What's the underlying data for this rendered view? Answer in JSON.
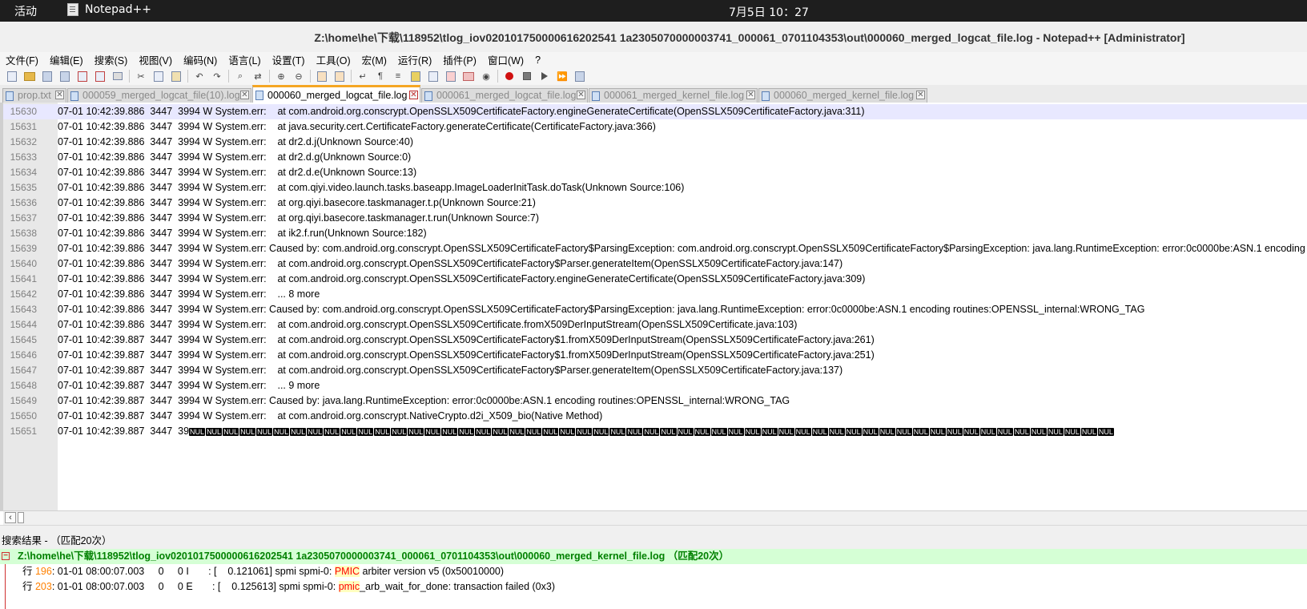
{
  "topbar": {
    "activities": "活动",
    "app_name": "Notepad++",
    "clock": "7月5日  10：27"
  },
  "window": {
    "title": "Z:\\home\\he\\下载\\118952\\tlog_iov020101750000616202541 1a2305070000003741_000061_0701104353\\out\\000060_merged_logcat_file.log - Notepad++ [Administrator]"
  },
  "menu": [
    "文件(F)",
    "编辑(E)",
    "搜索(S)",
    "视图(V)",
    "编码(N)",
    "语言(L)",
    "设置(T)",
    "工具(O)",
    "宏(M)",
    "运行(R)",
    "插件(P)",
    "窗口(W)",
    "?"
  ],
  "tabs": [
    {
      "label": "prop.txt",
      "active": false
    },
    {
      "label": "000059_merged_logcat_file(10).log",
      "active": false
    },
    {
      "label": "000060_merged_logcat_file.log",
      "active": true
    },
    {
      "label": "000061_merged_logcat_file.log",
      "active": false
    },
    {
      "label": "000061_merged_kernel_file.log",
      "active": false
    },
    {
      "label": "000060_merged_kernel_file.log",
      "active": false
    }
  ],
  "editor": {
    "lines": [
      {
        "num": "15630",
        "text": "07-01 10:42:39.886  3447  3994 W System.err:    at com.android.org.conscrypt.OpenSSLX509CertificateFactory.engineGenerateCertificate(OpenSSLX509CertificateFactory.java:311)"
      },
      {
        "num": "15631",
        "text": "07-01 10:42:39.886  3447  3994 W System.err:    at java.security.cert.CertificateFactory.generateCertificate(CertificateFactory.java:366)"
      },
      {
        "num": "15632",
        "text": "07-01 10:42:39.886  3447  3994 W System.err:    at dr2.d.j(Unknown Source:40)"
      },
      {
        "num": "15633",
        "text": "07-01 10:42:39.886  3447  3994 W System.err:    at dr2.d.g(Unknown Source:0)"
      },
      {
        "num": "15634",
        "text": "07-01 10:42:39.886  3447  3994 W System.err:    at dr2.d.e(Unknown Source:13)"
      },
      {
        "num": "15635",
        "text": "07-01 10:42:39.886  3447  3994 W System.err:    at com.qiyi.video.launch.tasks.baseapp.ImageLoaderInitTask.doTask(Unknown Source:106)"
      },
      {
        "num": "15636",
        "text": "07-01 10:42:39.886  3447  3994 W System.err:    at org.qiyi.basecore.taskmanager.t.p(Unknown Source:21)"
      },
      {
        "num": "15637",
        "text": "07-01 10:42:39.886  3447  3994 W System.err:    at org.qiyi.basecore.taskmanager.t.run(Unknown Source:7)"
      },
      {
        "num": "15638",
        "text": "07-01 10:42:39.886  3447  3994 W System.err:    at ik2.f.run(Unknown Source:182)"
      },
      {
        "num": "15639",
        "text": "07-01 10:42:39.886  3447  3994 W System.err: Caused by: com.android.org.conscrypt.OpenSSLX509CertificateFactory$ParsingException: com.android.org.conscrypt.OpenSSLX509CertificateFactory$ParsingException: java.lang.RuntimeException: error:0c0000be:ASN.1 encoding routines:OPENSSL_internal:WRONG_TAG"
      },
      {
        "num": "15640",
        "text": "07-01 10:42:39.886  3447  3994 W System.err:    at com.android.org.conscrypt.OpenSSLX509CertificateFactory$Parser.generateItem(OpenSSLX509CertificateFactory.java:147)"
      },
      {
        "num": "15641",
        "text": "07-01 10:42:39.886  3447  3994 W System.err:    at com.android.org.conscrypt.OpenSSLX509CertificateFactory.engineGenerateCertificate(OpenSSLX509CertificateFactory.java:309)"
      },
      {
        "num": "15642",
        "text": "07-01 10:42:39.886  3447  3994 W System.err:    ... 8 more"
      },
      {
        "num": "15643",
        "text": "07-01 10:42:39.886  3447  3994 W System.err: Caused by: com.android.org.conscrypt.OpenSSLX509CertificateFactory$ParsingException: java.lang.RuntimeException: error:0c0000be:ASN.1 encoding routines:OPENSSL_internal:WRONG_TAG"
      },
      {
        "num": "15644",
        "text": "07-01 10:42:39.886  3447  3994 W System.err:    at com.android.org.conscrypt.OpenSSLX509Certificate.fromX509DerInputStream(OpenSSLX509Certificate.java:103)"
      },
      {
        "num": "15645",
        "text": "07-01 10:42:39.887  3447  3994 W System.err:    at com.android.org.conscrypt.OpenSSLX509CertificateFactory$1.fromX509DerInputStream(OpenSSLX509CertificateFactory.java:261)"
      },
      {
        "num": "15646",
        "text": "07-01 10:42:39.887  3447  3994 W System.err:    at com.android.org.conscrypt.OpenSSLX509CertificateFactory$1.fromX509DerInputStream(OpenSSLX509CertificateFactory.java:251)"
      },
      {
        "num": "15647",
        "text": "07-01 10:42:39.887  3447  3994 W System.err:    at com.android.org.conscrypt.OpenSSLX509CertificateFactory$Parser.generateItem(OpenSSLX509CertificateFactory.java:137)"
      },
      {
        "num": "15648",
        "text": "07-01 10:42:39.887  3447  3994 W System.err:    ... 9 more"
      },
      {
        "num": "15649",
        "text": "07-01 10:42:39.887  3447  3994 W System.err: Caused by: java.lang.RuntimeException: error:0c0000be:ASN.1 encoding routines:OPENSSL_internal:WRONG_TAG"
      },
      {
        "num": "15650",
        "text": "07-01 10:42:39.887  3447  3994 W System.err:    at com.android.org.conscrypt.NativeCrypto.d2i_X509_bio(Native Method)"
      },
      {
        "num": "15651",
        "text": "07-01 10:42:39.887  3447  39"
      }
    ],
    "nul_label": "NUL",
    "nul_count": 55
  },
  "search_results": {
    "header": "搜索结果 - （匹配20次）",
    "file": "Z:\\home\\he\\下载\\118952\\tlog_iov0201017500000616202541 1a2305070000003741_000061_0701104353\\out\\000060_merged_kernel_file.log （匹配20次）",
    "rows": [
      {
        "label": "行 ",
        "line": "196",
        "pre": ": 01-01 08:00:07.003     0     0 I       : [    0.121061] spmi spmi-0: ",
        "hit": "PMIC",
        "post": " arbiter version v5 (0x50010000)"
      },
      {
        "label": "行 ",
        "line": "203",
        "pre": ": 01-01 08:00:07.003     0     0 E       : [    0.125613] spmi spmi-0: ",
        "hit": "pmic",
        "post": "_arb_wait_for_done: transaction failed (0x3)"
      }
    ]
  }
}
